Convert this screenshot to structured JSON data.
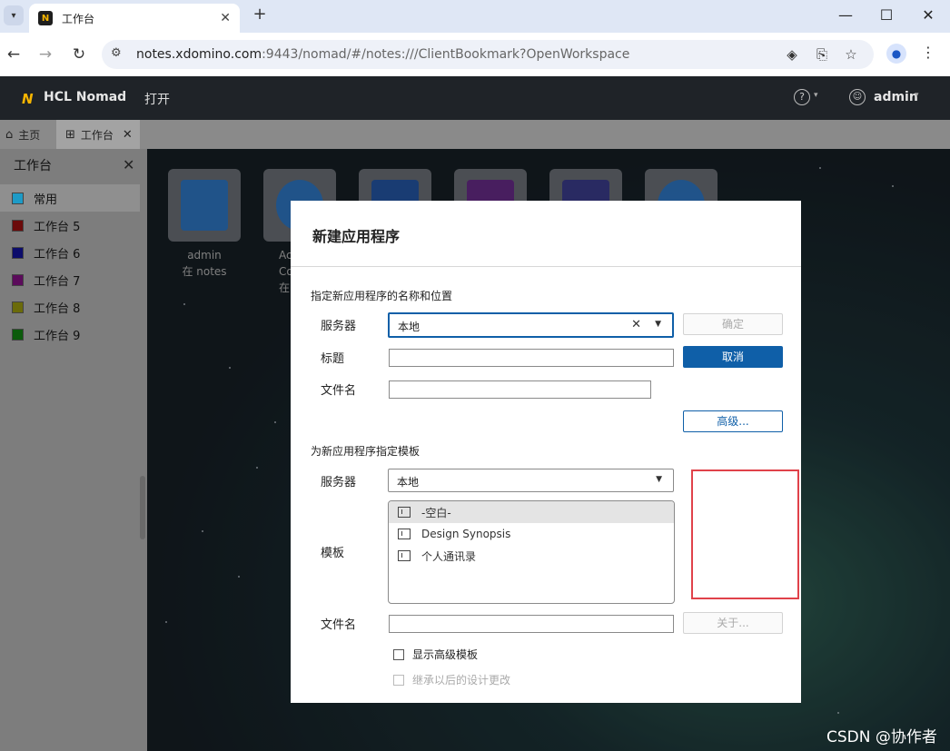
{
  "browser": {
    "tab_title": "工作台",
    "favicon_glyph": "N",
    "new_tab": "+",
    "url_host": "notes.xdomino.com",
    "url_rest": ":9443/nomad/#/notes:///ClientBookmark?OpenWorkspace",
    "win_minimize": "—",
    "win_maximize": "☐",
    "win_close": "✕"
  },
  "app": {
    "logo_glyph": "N",
    "name": "HCL Nomad",
    "open_menu": "打开",
    "help_glyph": "?",
    "user": "admin"
  },
  "app_tabs": [
    {
      "label": "主页"
    },
    {
      "label": "工作台"
    }
  ],
  "sidebar": {
    "title": "工作台",
    "items": [
      {
        "label": "常用",
        "color": "#1d9bc7"
      },
      {
        "label": "工作台 5",
        "color": "#6b0a0a"
      },
      {
        "label": "工作台 6",
        "color": "#0c0c6b"
      },
      {
        "label": "工作台 7",
        "color": "#5b0b5b"
      },
      {
        "label": "工作台 8",
        "color": "#6b6b0a"
      },
      {
        "label": "工作台 9",
        "color": "#0b5b0b"
      }
    ]
  },
  "workspace": {
    "tile1_line1": "admin",
    "tile1_line2": "在 notes",
    "tile2_line1": "Ac",
    "tile2_line2": "Co",
    "tile2_line3": "在"
  },
  "dialog": {
    "title": "新建应用程序",
    "section1": "指定新应用程序的名称和位置",
    "server_label": "服务器",
    "server_value": "本地",
    "title_label": "标题",
    "filename_label": "文件名",
    "ok_button": "确定",
    "cancel_button": "取消",
    "advanced_button": "高级...",
    "section2": "为新应用程序指定模板",
    "tpl_server_label": "服务器",
    "tpl_server_value": "本地",
    "template_label": "模板",
    "templates": [
      {
        "label": "-空白-"
      },
      {
        "label": "Design Synopsis"
      },
      {
        "label": "个人通讯录"
      }
    ],
    "tpl_filename_label": "文件名",
    "about_button": "关于...",
    "show_advanced": "显示高级模板",
    "inherit_changes": "继承以后的设计更改"
  },
  "watermark": "CSDN @协作者",
  "colors": {
    "primary": "#0f5fa8",
    "highlight": "#e0424a"
  }
}
